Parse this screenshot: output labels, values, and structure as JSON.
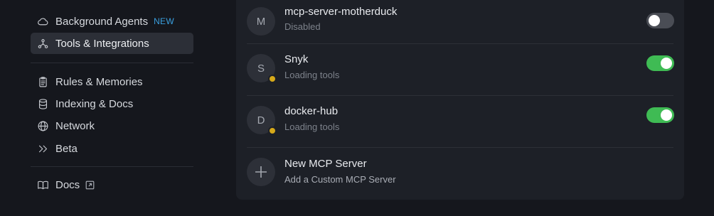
{
  "sidebar": {
    "items": [
      {
        "label": "Background Agents",
        "badge": "NEW",
        "icon": "cloud-icon"
      },
      {
        "label": "Tools & Integrations",
        "icon": "nodes-icon",
        "active": true
      },
      {
        "label": "Rules & Memories",
        "icon": "clipboard-icon"
      },
      {
        "label": "Indexing & Docs",
        "icon": "database-icon"
      },
      {
        "label": "Network",
        "icon": "globe-icon"
      },
      {
        "label": "Beta",
        "icon": "chevrons-right-icon"
      },
      {
        "label": "Docs",
        "icon": "book-icon",
        "external": true
      }
    ]
  },
  "servers": [
    {
      "initial": "M",
      "name": "mcp-server-motherduck",
      "status": "Disabled",
      "enabled": false,
      "loading": false
    },
    {
      "initial": "S",
      "name": "Snyk",
      "status": "Loading tools",
      "enabled": true,
      "loading": true
    },
    {
      "initial": "D",
      "name": "docker-hub",
      "status": "Loading tools",
      "enabled": true,
      "loading": true
    }
  ],
  "new_server": {
    "title": "New MCP Server",
    "subtitle": "Add a Custom MCP Server"
  },
  "colors": {
    "accent_blue": "#3aa0e0",
    "toggle_on": "#3fbb54",
    "loading_dot": "#d6a91a"
  }
}
